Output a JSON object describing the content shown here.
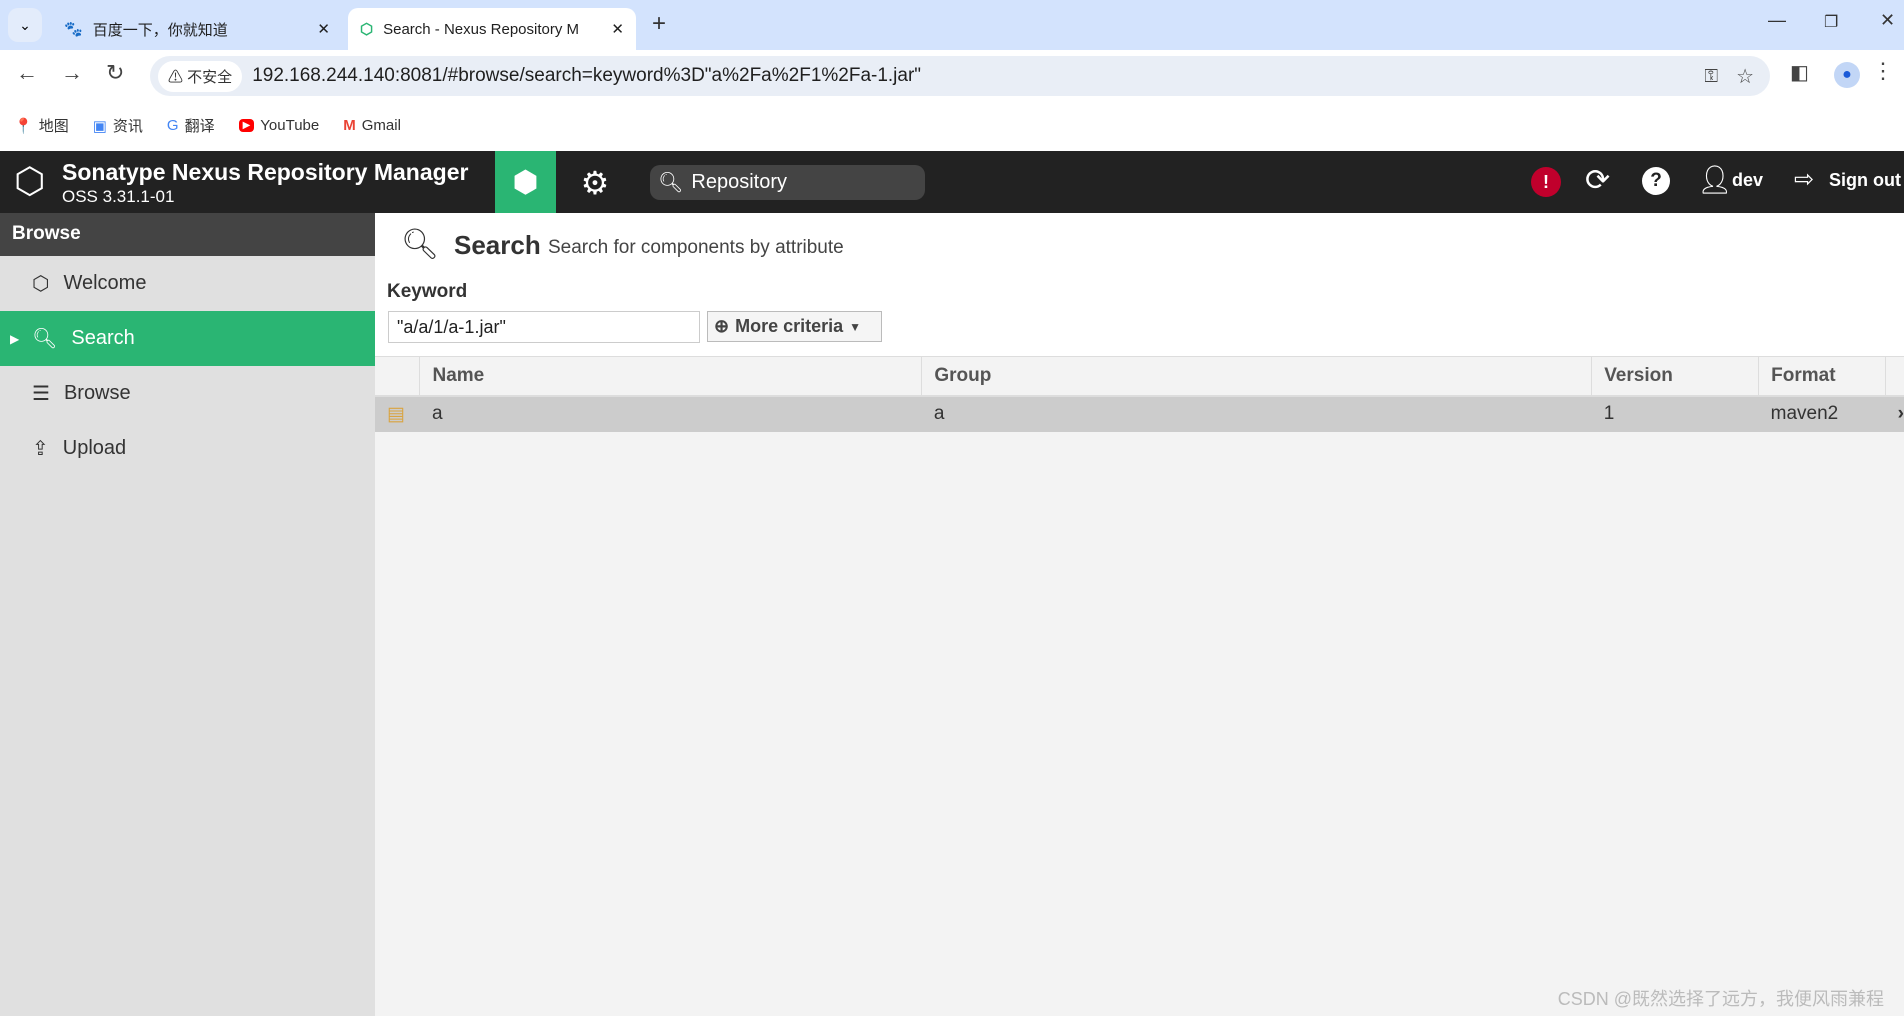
{
  "browser": {
    "tabs": [
      {
        "label": "百度一下，你就知道",
        "active": false
      },
      {
        "label": "Search - Nexus Repository M",
        "active": true
      }
    ],
    "security_label": "不安全",
    "url": "192.168.244.140:8081/#browse/search=keyword%3D\"a%2Fa%2F1%2Fa-1.jar\"",
    "bookmarks": [
      {
        "label": "地图"
      },
      {
        "label": "资讯"
      },
      {
        "label": "翻译"
      },
      {
        "label": "YouTube"
      },
      {
        "label": "Gmail"
      }
    ]
  },
  "app": {
    "title": "Sonatype Nexus Repository Manager",
    "version": "OSS 3.31.1-01",
    "search_placeholder": "Repository",
    "user": "dev",
    "sign_out": "Sign out",
    "accent": "#2ab573",
    "alert_color": "#c0002c"
  },
  "sidebar": {
    "header": "Browse",
    "items": [
      {
        "label": "Welcome",
        "icon": "hexagon-icon"
      },
      {
        "label": "Search",
        "icon": "search-icon",
        "active": true
      },
      {
        "label": "Browse",
        "icon": "database-icon"
      },
      {
        "label": "Upload",
        "icon": "upload-icon"
      }
    ]
  },
  "main": {
    "title": "Search",
    "subtitle": "Search for components by attribute",
    "keyword_label": "Keyword",
    "keyword_value": "\"a/a/1/a-1.jar\"",
    "more_criteria": "More criteria",
    "columns": [
      "Name",
      "Group",
      "Version",
      "Format"
    ],
    "rows": [
      {
        "name": "a",
        "group": "a",
        "version": "1",
        "format": "maven2"
      }
    ]
  },
  "watermark": "CSDN @既然选择了远方，我便风雨兼程"
}
